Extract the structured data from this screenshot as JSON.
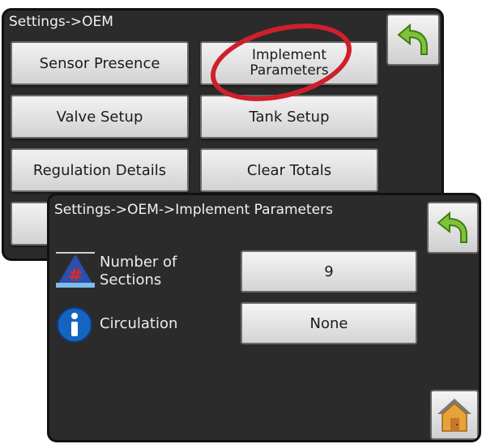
{
  "oem_screen": {
    "breadcrumb": "Settings->OEM",
    "buttons": {
      "sensor_presence": "Sensor Presence",
      "implement_parameters_line1": "Implement",
      "implement_parameters_line2": "Parameters",
      "valve_setup": "Valve Setup",
      "tank_setup": "Tank Setup",
      "regulation_details": "Regulation Details",
      "clear_totals": "Clear Totals"
    },
    "back_icon": "back-arrow-icon",
    "highlight_color": "#d01f2c"
  },
  "implement_screen": {
    "breadcrumb": "Settings->OEM->Implement Parameters",
    "rows": [
      {
        "label_line1": "Number of",
        "label_line2": "Sections",
        "icon": "number-sections-icon",
        "value": "9"
      },
      {
        "label_line1": "Circulation",
        "icon": "info-icon",
        "value": "None"
      }
    ],
    "back_icon": "back-arrow-icon",
    "home_icon": "home-icon"
  },
  "colors": {
    "screen_bg": "#2b2b2b",
    "button_bg": "#e6e6e6",
    "accent_green": "#7fc23a",
    "info_blue": "#1565c0",
    "home_orange": "#e8a23a"
  }
}
